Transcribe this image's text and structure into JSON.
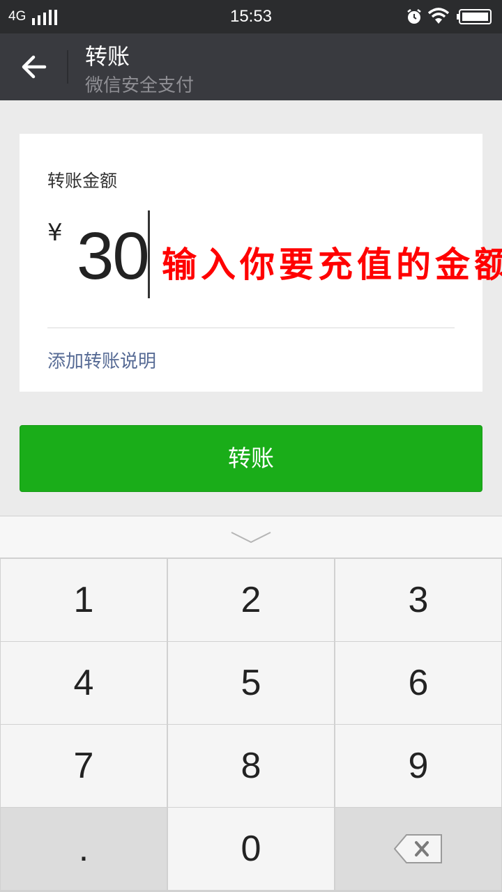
{
  "status_bar": {
    "network": "4G",
    "time": "15:53",
    "icons": [
      "signal-icon",
      "alarm-icon",
      "wifi-icon",
      "battery-icon"
    ]
  },
  "header": {
    "title": "转账",
    "subtitle": "微信安全支付",
    "back_icon": "arrow-left-icon"
  },
  "form": {
    "amount_label": "转账金额",
    "currency_symbol": "¥",
    "amount_value": "30",
    "overlay_annotation": "输入你要充值的金额",
    "add_remark_link": "添加转账说明"
  },
  "primary_button": {
    "label": "转账"
  },
  "keyboard": {
    "collapse_icon": "chevron-down-icon",
    "keys": [
      "1",
      "2",
      "3",
      "4",
      "5",
      "6",
      "7",
      "8",
      "9",
      ".",
      "0"
    ],
    "delete_icon": "backspace-icon"
  },
  "colors": {
    "header_bg": "#393a3f",
    "status_bar_bg": "#2b2c2e",
    "primary_green": "#1aad19",
    "link_blue": "#576b95",
    "annotation_red": "#ff0000",
    "page_bg": "#ebebeb"
  }
}
